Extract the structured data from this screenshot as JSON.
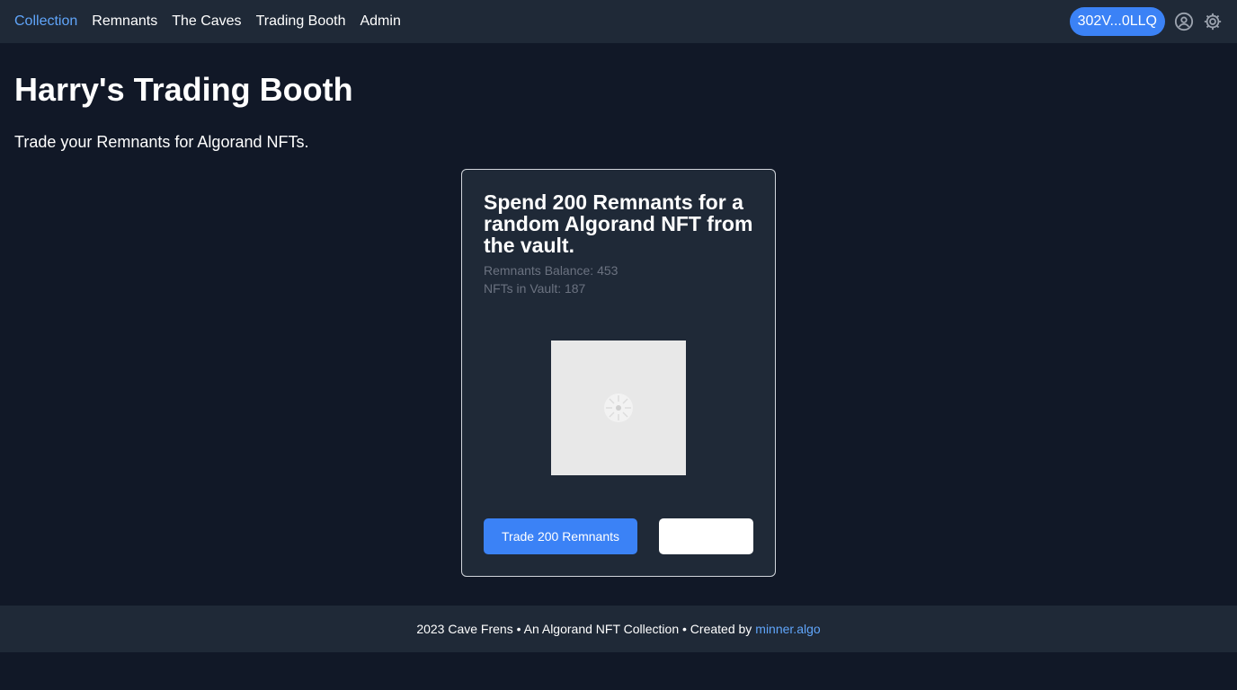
{
  "nav": {
    "links": [
      {
        "label": "Collection",
        "active": true
      },
      {
        "label": "Remnants",
        "active": false
      },
      {
        "label": "The Caves",
        "active": false
      },
      {
        "label": "Trading Booth",
        "active": false
      },
      {
        "label": "Admin",
        "active": false
      }
    ],
    "wallet_label": "302V...0LLQ",
    "icons": [
      "user-circle-icon",
      "gear-icon"
    ]
  },
  "page": {
    "title": "Harry's Trading Booth",
    "subtitle": "Trade your Remnants for Algorand NFTs."
  },
  "card": {
    "title": "Spend 200 Remnants for a random Algorand NFT from the vault.",
    "balance_text": "Remnants Balance: 453",
    "vault_text": "NFTs in Vault: 187",
    "image_state": "loading-spinner-icon",
    "trade_button_label": "Trade 200 Remnants",
    "secondary_button_label": ""
  },
  "footer": {
    "text": "2023 Cave Frens • An Algorand NFT Collection • Created by",
    "link_label": "minner.algo"
  },
  "colors": {
    "background": "#111827",
    "surface": "#1f2937",
    "accent": "#3b82f6",
    "link": "#60a5fa",
    "muted_text": "#6b7280"
  }
}
